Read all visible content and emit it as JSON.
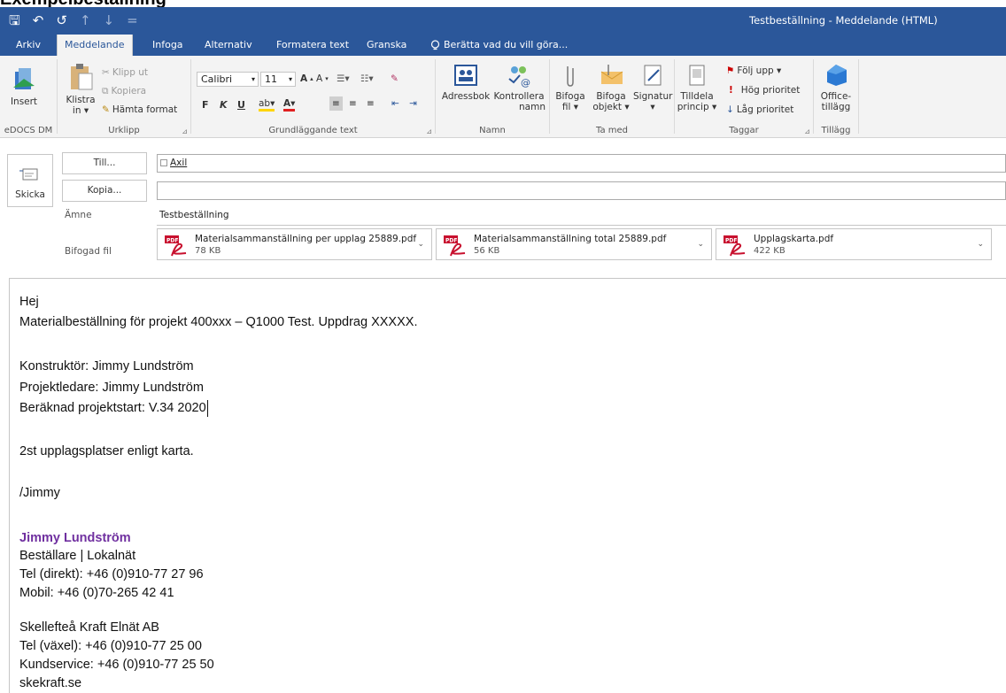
{
  "doc_heading": "Exempelbeställning",
  "window": {
    "title": "Testbeställning - Meddelande (HTML)"
  },
  "qat": {
    "save": "🖫",
    "undo": "↶",
    "redo": "↺",
    "up": "↑",
    "down": "↓",
    "more": "="
  },
  "tabs": [
    "Arkiv",
    "Meddelande",
    "Infoga",
    "Alternativ",
    "Formatera text",
    "Granska"
  ],
  "tell_me": "Berätta vad du vill göra...",
  "ribbon": {
    "edocs": {
      "insert": "Insert",
      "label": "eDOCS DM"
    },
    "clipboard": {
      "paste_line1": "Klistra",
      "paste_line2": "in ▾",
      "cut": "Klipp ut",
      "copy": "Kopiera",
      "format_painter": "Hämta format",
      "label": "Urklipp"
    },
    "text": {
      "font": "Calibri",
      "size": "11",
      "bold": "F",
      "italic": "K",
      "underline": "U",
      "label": "Grundläggande text"
    },
    "names": {
      "addressbook": "Adressbok",
      "check_line1": "Kontrollera",
      "check_line2": "namn",
      "label": "Namn"
    },
    "include": {
      "attach_file_1": "Bifoga",
      "attach_file_2": "fil ▾",
      "attach_item_1": "Bifoga",
      "attach_item_2": "objekt ▾",
      "signature_1": "Signatur",
      "signature_2": "▾",
      "label": "Ta med"
    },
    "tags": {
      "assign_1": "Tilldela",
      "assign_2": "princip ▾",
      "followup": "Följ upp ▾",
      "high": "Hög prioritet",
      "low": "Låg prioritet",
      "label": "Taggar"
    },
    "addins": {
      "office_1": "Office-",
      "office_2": "tillägg",
      "label": "Tillägg"
    }
  },
  "compose": {
    "send": "Skicka",
    "to_button": "Till...",
    "to_value": "Axil",
    "cc_button": "Kopia...",
    "cc_value": "",
    "subject_label": "Ämne",
    "subject_value": "Testbeställning",
    "attach_label": "Bifogad fil",
    "attachments": [
      {
        "name": "Materialsammanställning per upplag 25889.pdf",
        "size": "78 KB"
      },
      {
        "name": "Materialsammanställning total 25889.pdf",
        "size": "56 KB"
      },
      {
        "name": "Upplagskarta.pdf",
        "size": "422 KB"
      }
    ]
  },
  "body": {
    "greeting": "Hej",
    "line1": "Materialbeställning för projekt 400xxx – Q1000 Test. Uppdrag XXXXX.",
    "constructor": "Konstruktör: Jimmy Lundström",
    "pm": "Projektledare: Jimmy Lundström",
    "start": "Beräknad projektstart: V.34 2020",
    "places": "2st upplagsplatser enligt karta.",
    "closing": "/Jimmy",
    "sig_name": "Jimmy Lundström",
    "sig_role": "Beställare | Lokalnät",
    "sig_tel": "Tel (direkt): +46 (0)910-77 27 96",
    "sig_mobile": "Mobil: +46 (0)70-265 42 41",
    "company": "Skellefteå Kraft Elnät AB",
    "company_tel": "Tel (växel): +46 (0)910-77 25 00",
    "customer": "Kundservice: +46 (0)910-77 25 50",
    "website": "skekraft.se"
  },
  "colors": {
    "brand": "#2b579a",
    "signature": "#7030a0",
    "pdf_red": "#c8102e"
  }
}
